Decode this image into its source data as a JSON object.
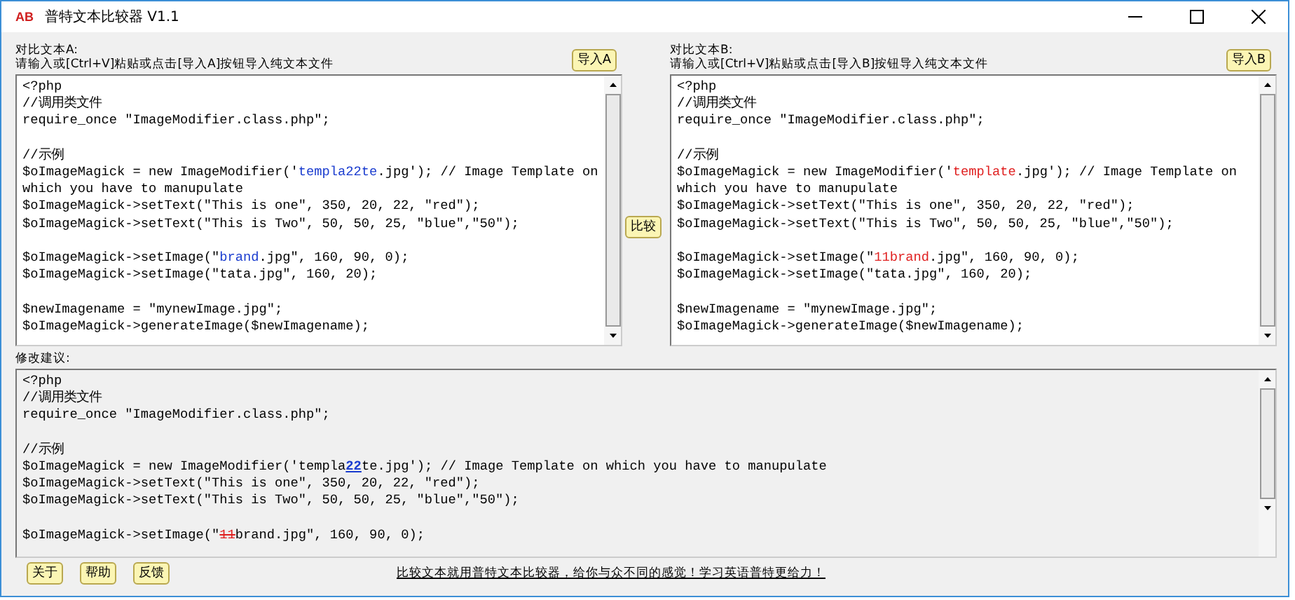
{
  "window": {
    "logo": "AB",
    "title": "普特文本比较器 V1.1"
  },
  "panel_a": {
    "label": "对比文本A:",
    "hint": "请输入或[Ctrl+V]粘贴或点击[导入A]按钮导入纯文本文件",
    "import_button": "导入A",
    "lines": [
      {
        "kind": "code",
        "parts": [
          {
            "text": "<?php",
            "kind": "plain"
          }
        ]
      },
      {
        "kind": "code",
        "parts": [
          {
            "text": "//调用类文件",
            "kind": "plain"
          }
        ]
      },
      {
        "kind": "code",
        "parts": [
          {
            "text": "require_once \"ImageModifier.class.php\";",
            "kind": "plain"
          }
        ]
      },
      {
        "kind": "blank"
      },
      {
        "kind": "code",
        "parts": [
          {
            "text": "//示例",
            "kind": "plain"
          }
        ]
      },
      {
        "kind": "code",
        "parts": [
          {
            "text": "$oImageMagick = new ImageModifier('",
            "kind": "plain"
          },
          {
            "text": "templa22te",
            "kind": "diff_a"
          },
          {
            "text": ".jpg'); // Image Template on which you have to manupulate",
            "kind": "plain"
          }
        ]
      },
      {
        "kind": "code",
        "parts": [
          {
            "text": "$oImageMagick->setText(\"This is one\", 350, 20, 22, \"red\");",
            "kind": "plain"
          }
        ]
      },
      {
        "kind": "code",
        "parts": [
          {
            "text": "$oImageMagick->setText(\"This is Two\", 50, 50, 25, \"blue\",\"50\");",
            "kind": "plain"
          }
        ]
      },
      {
        "kind": "blank"
      },
      {
        "kind": "code",
        "parts": [
          {
            "text": "$oImageMagick->setImage(\"",
            "kind": "plain"
          },
          {
            "text": "brand",
            "kind": "diff_a"
          },
          {
            "text": ".jpg\", 160, 90, 0);",
            "kind": "plain"
          }
        ]
      },
      {
        "kind": "code",
        "parts": [
          {
            "text": "$oImageMagick->setImage(\"tata.jpg\", 160, 20);",
            "kind": "plain"
          }
        ]
      },
      {
        "kind": "blank"
      },
      {
        "kind": "code",
        "parts": [
          {
            "text": "$newImagename = \"mynewImage.jpg\";",
            "kind": "plain"
          }
        ]
      },
      {
        "kind": "code",
        "parts": [
          {
            "text": "$oImageMagick->generateImage($newImagename);",
            "kind": "plain"
          }
        ]
      }
    ]
  },
  "compare_button": "比较",
  "panel_b": {
    "label": "对比文本B:",
    "hint": "请输入或[Ctrl+V]粘贴或点击[导入B]按钮导入纯文本文件",
    "import_button": "导入B",
    "lines": [
      {
        "kind": "code",
        "parts": [
          {
            "text": "<?php",
            "kind": "plain"
          }
        ]
      },
      {
        "kind": "code",
        "parts": [
          {
            "text": "//调用类文件",
            "kind": "plain"
          }
        ]
      },
      {
        "kind": "code",
        "parts": [
          {
            "text": "require_once \"ImageModifier.class.php\";",
            "kind": "plain"
          }
        ]
      },
      {
        "kind": "blank"
      },
      {
        "kind": "code",
        "parts": [
          {
            "text": "//示例",
            "kind": "plain"
          }
        ]
      },
      {
        "kind": "code",
        "parts": [
          {
            "text": "$oImageMagick = new ImageModifier('",
            "kind": "plain"
          },
          {
            "text": "template",
            "kind": "diff_b"
          },
          {
            "text": ".jpg'); // Image Template on which you have to manupulate",
            "kind": "plain"
          }
        ]
      },
      {
        "kind": "code",
        "parts": [
          {
            "text": "$oImageMagick->setText(\"This is one\", 350, 20, 22, \"red\");",
            "kind": "plain"
          }
        ]
      },
      {
        "kind": "code",
        "parts": [
          {
            "text": "$oImageMagick->setText(\"This is Two\", 50, 50, 25, \"blue\",\"50\");",
            "kind": "plain"
          }
        ]
      },
      {
        "kind": "blank"
      },
      {
        "kind": "code",
        "parts": [
          {
            "text": "$oImageMagick->setImage(\"",
            "kind": "plain"
          },
          {
            "text": "11brand",
            "kind": "diff_b"
          },
          {
            "text": ".jpg\", 160, 90, 0);",
            "kind": "plain"
          }
        ]
      },
      {
        "kind": "code",
        "parts": [
          {
            "text": "$oImageMagick->setImage(\"tata.jpg\", 160, 20);",
            "kind": "plain"
          }
        ]
      },
      {
        "kind": "blank"
      },
      {
        "kind": "code",
        "parts": [
          {
            "text": "$newImagename = \"mynewImage.jpg\";",
            "kind": "plain"
          }
        ]
      },
      {
        "kind": "code",
        "parts": [
          {
            "text": "$oImageMagick->generateImage($newImagename);",
            "kind": "plain"
          }
        ]
      }
    ]
  },
  "suggestions": {
    "label": "修改建议:",
    "lines": [
      {
        "kind": "code",
        "parts": [
          {
            "text": "<?php",
            "kind": "plain"
          }
        ]
      },
      {
        "kind": "code",
        "parts": [
          {
            "text": "//调用类文件",
            "kind": "plain"
          }
        ]
      },
      {
        "kind": "code",
        "parts": [
          {
            "text": "require_once \"ImageModifier.class.php\";",
            "kind": "plain"
          }
        ]
      },
      {
        "kind": "blank"
      },
      {
        "kind": "code",
        "parts": [
          {
            "text": "//示例",
            "kind": "plain"
          }
        ]
      },
      {
        "kind": "code",
        "parts": [
          {
            "text": "$oImageMagick = new ImageModifier('templa",
            "kind": "plain"
          },
          {
            "text": "22",
            "kind": "inserted"
          },
          {
            "text": "te.jpg'); // Image Template on which you have to manupulate",
            "kind": "plain"
          }
        ]
      },
      {
        "kind": "code",
        "parts": [
          {
            "text": "$oImageMagick->setText(\"This is one\", 350, 20, 22, \"red\");",
            "kind": "plain"
          }
        ]
      },
      {
        "kind": "code",
        "parts": [
          {
            "text": "$oImageMagick->setText(\"This is Two\", 50, 50, 25, \"blue\",\"50\");",
            "kind": "plain"
          }
        ]
      },
      {
        "kind": "blank"
      },
      {
        "kind": "code",
        "parts": [
          {
            "text": "$oImageMagick->setImage(\"",
            "kind": "plain"
          },
          {
            "text": "11",
            "kind": "deleted"
          },
          {
            "text": "brand.jpg\", 160, 90, 0);",
            "kind": "plain"
          }
        ]
      }
    ]
  },
  "footer": {
    "buttons": [
      "关于",
      "帮助",
      "反馈"
    ],
    "link": "比较文本就用普特文本比较器，给你与众不同的感觉！学习英语普特更给力！"
  }
}
